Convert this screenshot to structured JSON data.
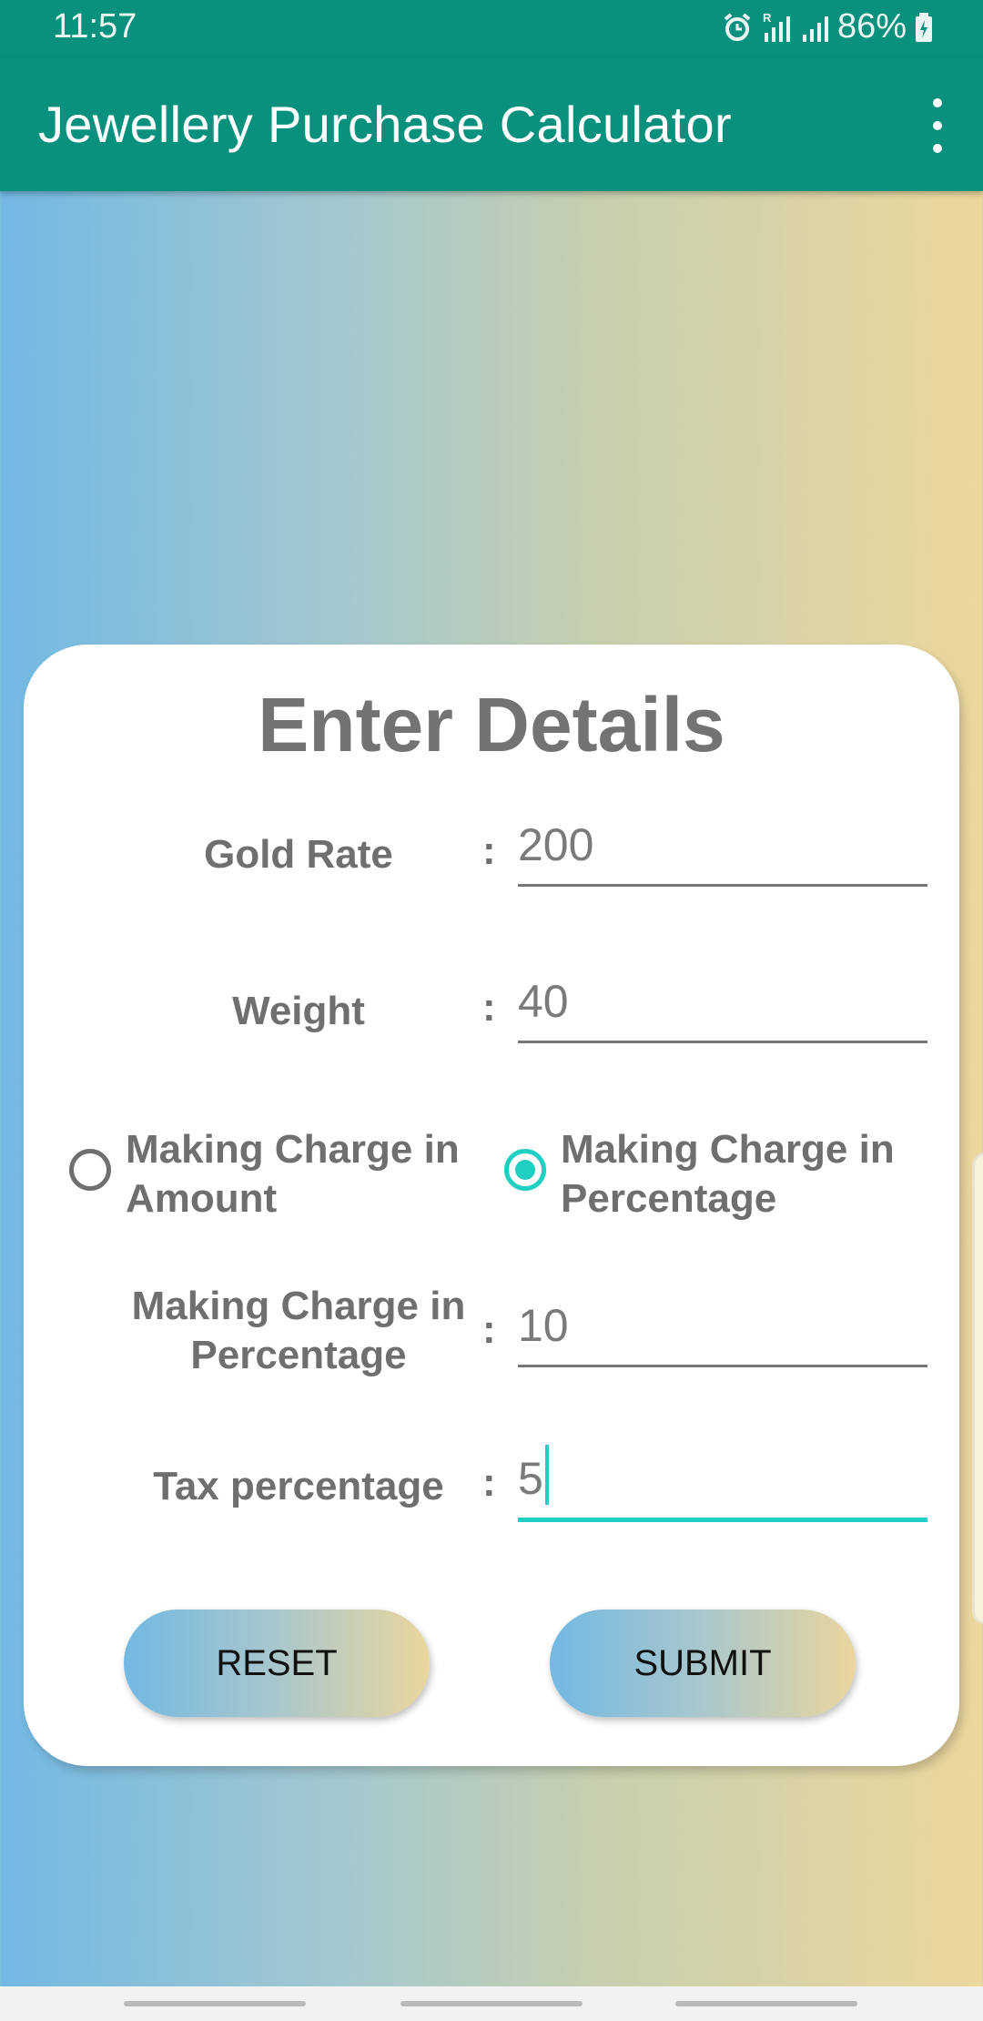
{
  "status_bar": {
    "time": "11:57",
    "battery": "86%",
    "icons": [
      "alarm-icon",
      "signal-r-icon",
      "signal-icon",
      "battery-charging-icon"
    ]
  },
  "app_bar": {
    "title": "Jewellery Purchase Calculator",
    "menu_icon": "more-vert-icon"
  },
  "card": {
    "heading": "Enter Details",
    "colon": ":",
    "gold_rate": {
      "label": "Gold Rate",
      "value": "200"
    },
    "weight": {
      "label": "Weight",
      "value": "40"
    },
    "making_charge_options": [
      {
        "label": "Making Charge in Amount",
        "selected": false
      },
      {
        "label": "Making Charge in Percentage",
        "selected": true
      }
    ],
    "making_charge": {
      "label": "Making Charge in Percentage",
      "value": "10"
    },
    "tax": {
      "label": "Tax percentage",
      "value": "5"
    },
    "buttons": {
      "reset": "RESET",
      "submit": "SUBMIT"
    }
  },
  "colors": {
    "app_bar": "#0a917e",
    "accent": "#1ecfc2",
    "gradient_start": "#72b9e3",
    "gradient_end": "#ecd79c"
  }
}
